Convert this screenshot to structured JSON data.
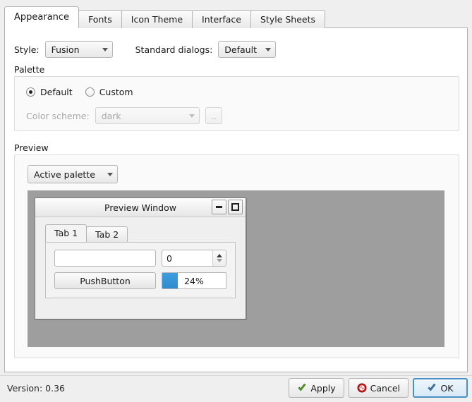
{
  "window": {
    "version_label": "Version: 0.36"
  },
  "tabs": [
    {
      "label": "Appearance",
      "active": true
    },
    {
      "label": "Fonts",
      "active": false
    },
    {
      "label": "Icon Theme",
      "active": false
    },
    {
      "label": "Interface",
      "active": false
    },
    {
      "label": "Style Sheets",
      "active": false
    }
  ],
  "appearance": {
    "style": {
      "label": "Style:",
      "value": "Fusion"
    },
    "standard_dialogs": {
      "label": "Standard dialogs:",
      "value": "Default"
    },
    "palette": {
      "group_label": "Palette",
      "radio_default": "Default",
      "radio_custom": "Custom",
      "selected": "Default",
      "color_scheme_label": "Color scheme:",
      "color_scheme_value": "dark",
      "browse_button": "...",
      "disabled": true
    },
    "preview": {
      "group_label": "Preview",
      "palette_selector": "Active palette",
      "window": {
        "title": "Preview Window",
        "minimize_icon": "minimize-icon",
        "maximize_icon": "maximize-icon",
        "tabs": [
          {
            "label": "Tab 1",
            "active": true
          },
          {
            "label": "Tab 2",
            "active": false
          }
        ],
        "line_edit_value": "",
        "line_edit_placeholder": "",
        "spinbox_value": "0",
        "push_button": "PushButton",
        "progress_text": "24%",
        "progress_percent": 24,
        "progress_color": "#2f8cce"
      }
    }
  },
  "footer": {
    "apply": "Apply",
    "cancel": "Cancel",
    "ok": "OK",
    "apply_icon": "check-green-icon",
    "cancel_icon": "cancel-red-icon",
    "ok_icon": "check-blue-icon"
  }
}
